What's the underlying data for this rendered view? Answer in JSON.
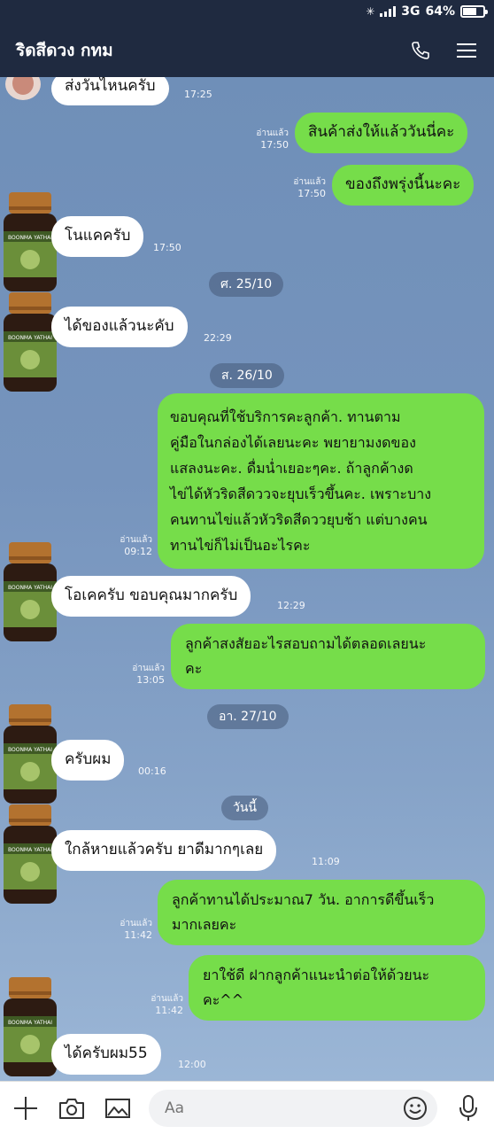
{
  "status_bar": {
    "network": "3G",
    "battery": "64%"
  },
  "header": {
    "title": "ริดสีดวง กทม",
    "call_icon": "phone-icon",
    "menu_icon": "menu-icon"
  },
  "colors": {
    "header_bg": "#1f2a40",
    "incoming_bubble": "#ffffff",
    "outgoing_bubble": "#76dd4a"
  },
  "messages": [
    {
      "dir": "in",
      "text": "ส่งวันไหนครับ",
      "time": "17:25"
    },
    {
      "dir": "out",
      "text": "สินค้าส่งให้แล้ววันนี่คะ",
      "read": "อ่านแล้ว",
      "time": "17:50"
    },
    {
      "dir": "out",
      "text": "ของถึงพรุ่งนี้นะคะ",
      "read": "อ่านแล้ว",
      "time": "17:50"
    },
    {
      "dir": "in",
      "text": "โนแคครับ",
      "time": "17:50"
    },
    {
      "dir": "in",
      "text": "ได้ของแล้วนะคับ",
      "time": "22:29"
    },
    {
      "dir": "out",
      "lines": [
        "ขอบคุณที่ใช้บริการคะลูกค้า. ทานตาม",
        "คู่มือในกล่องได้เลยนะคะ พยายามงดของ",
        "แสลงนะคะ. ดื่มน่ำเยอะๆคะ.  ถ้าลูกค้างด",
        "ไข่ได้หัวริดสีดววจะยุบเร็วขึ้นคะ. เพราะบาง",
        "คนทานไข่แล้วหัวริดสีดววยุบช้า แต่บางคน",
        "ทานไข่ก็ไม่เป็นอะไรคะ"
      ],
      "read": "อ่านแล้ว",
      "time": "09:12"
    },
    {
      "dir": "in",
      "text": "โอเคครับ ขอบคุณมากครับ",
      "time": "12:29"
    },
    {
      "dir": "out",
      "lines": [
        "ลูกค้าสงสัยอะไรสอบถามได้ตลอดเลยนะ",
        "คะ"
      ],
      "read": "อ่านแล้ว",
      "time": "13:05"
    },
    {
      "dir": "in",
      "text": "ครับผม",
      "time": "00:16"
    },
    {
      "dir": "in",
      "text": "ใกล้หายแล้วครับ ยาดีมากๆเลย",
      "time": "11:09"
    },
    {
      "dir": "out",
      "lines": [
        "ลูกค้าทานได้ประมาณ7 วัน. อาการดีขึ้นเร็ว",
        "มากเลยคะ"
      ],
      "read": "อ่านแล้ว",
      "time": "11:42"
    },
    {
      "dir": "out",
      "lines": [
        "ยาใช้ดี ฝากลูกค้าแนะนำต่อให้ด้วยนะ",
        "คะ^^"
      ],
      "read": "อ่านแล้ว",
      "time": "11:42"
    },
    {
      "dir": "in",
      "text": "ได้ครับผม55",
      "time": "12:00"
    }
  ],
  "dates": [
    "ศ. 25/10",
    "ส. 26/10",
    "อา. 27/10",
    "วันนี้"
  ],
  "avatar": {
    "brand_text": "BOONMA YATHAI"
  },
  "input_bar": {
    "placeholder": "Aa",
    "icons": [
      "plus-icon",
      "camera-icon",
      "image-icon",
      "emoji-icon",
      "microphone-icon"
    ]
  }
}
